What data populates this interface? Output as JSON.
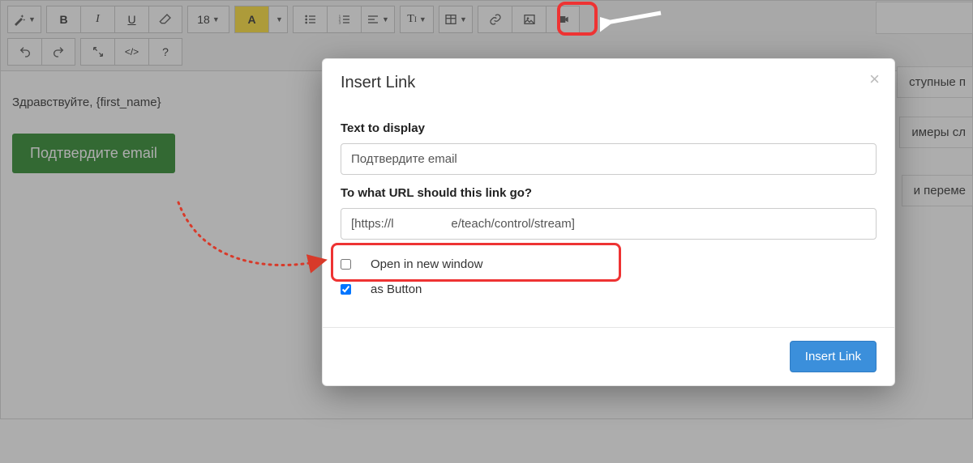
{
  "toolbar": {
    "style_label": "Style",
    "bold": "B",
    "italic": "I",
    "underline": "U",
    "eraser": "Clear formatting",
    "font_size": "18",
    "highlight": "A",
    "ul": "Unordered list",
    "ol": "Ordered list",
    "align": "Paragraph",
    "line_height": "Line height",
    "text_style": "T",
    "table": "Table",
    "link": "Link",
    "picture": "Picture",
    "video": "Video",
    "undo": "Undo",
    "redo": "Redo",
    "fullscreen": "Fullscreen",
    "codeview": "</>",
    "help": "?"
  },
  "editor": {
    "greeting": "Здравствуйте, {first_name}",
    "confirm_button": "Подтвердите email"
  },
  "right_panel": {
    "frag1": "ступные п",
    "frag2": "имеры сл",
    "frag3": "и переме"
  },
  "modal": {
    "title": "Insert Link",
    "close": "×",
    "text_label": "Text to display",
    "text_value": "Подтвердите email",
    "url_label": "To what URL should this link go?",
    "url_value": "[https://l                 e/teach/control/stream]",
    "open_new_window_label": "Open in new window",
    "open_new_window_checked": false,
    "as_button_label": "as Button",
    "as_button_checked": true,
    "submit": "Insert Link"
  }
}
